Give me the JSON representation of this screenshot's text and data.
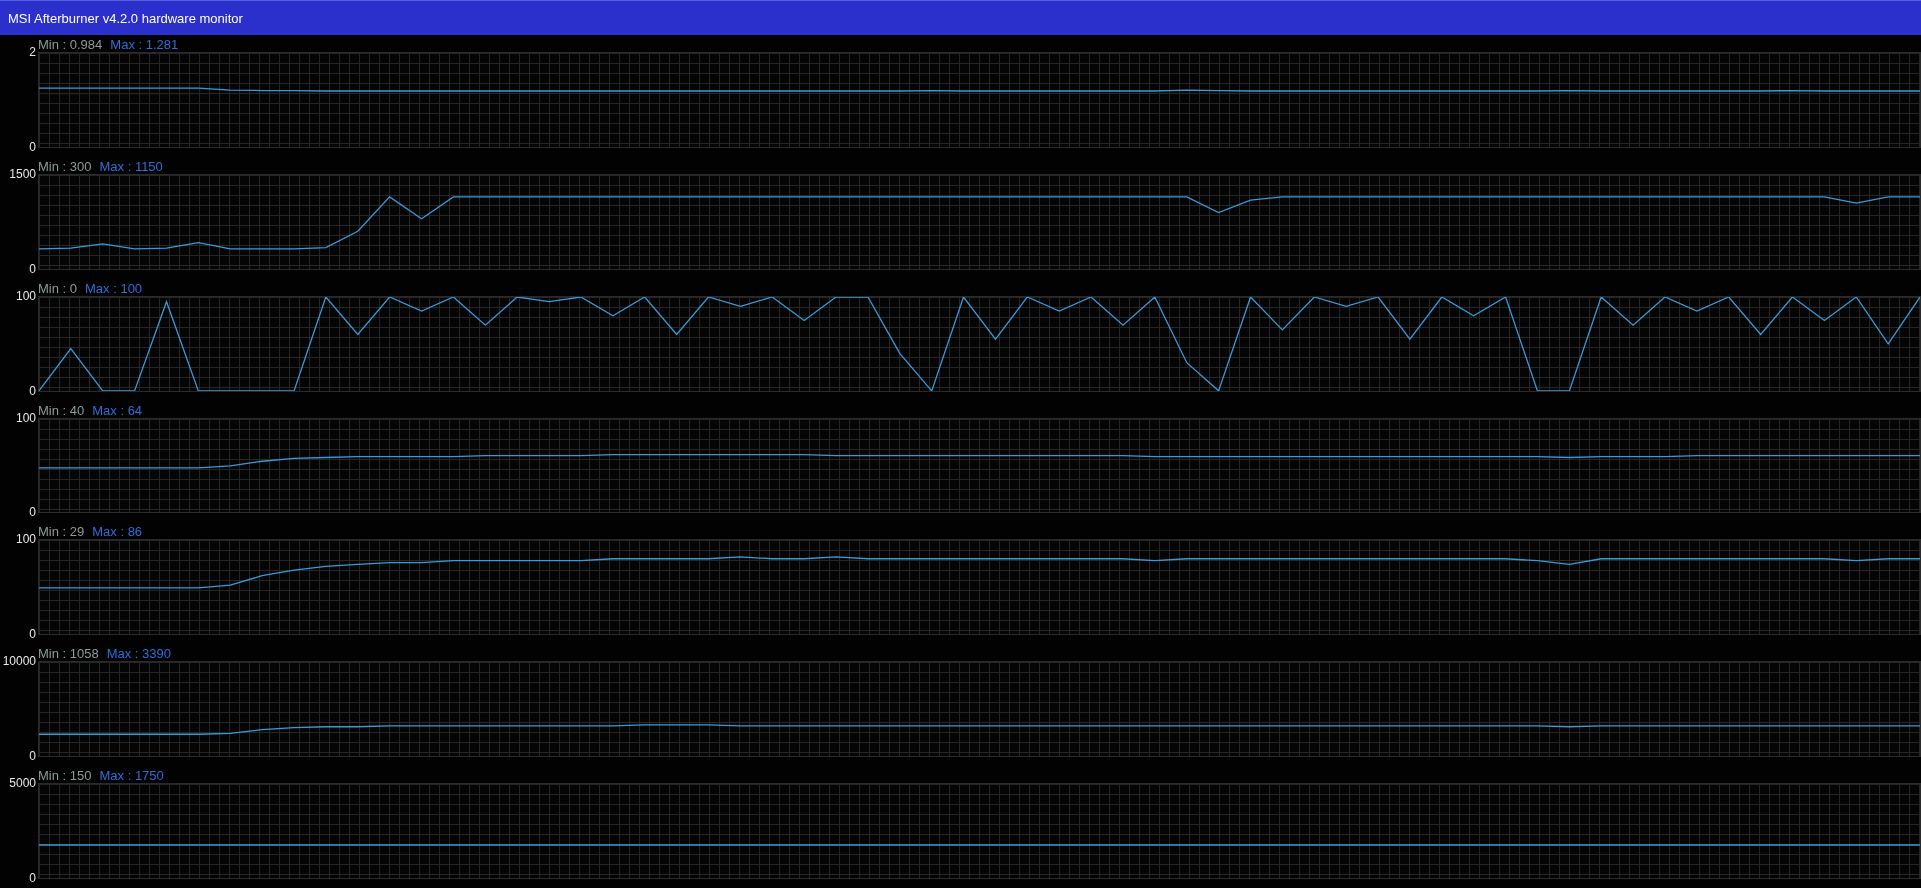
{
  "window": {
    "title": "MSI Afterburner v4.2.0 hardware monitor"
  },
  "graphs": [
    {
      "min_label": "Min : 0.984",
      "max_label": "Max : 1.281",
      "chart_data": {
        "type": "line",
        "ylim": [
          0,
          2
        ],
        "yticks": [
          0,
          2
        ],
        "series": [
          {
            "color": "#3a9ad9",
            "values": [
              1.25,
              1.25,
              1.25,
              1.25,
              1.25,
              1.25,
              1.21,
              1.2,
              1.2,
              1.19,
              1.19,
              1.19,
              1.19,
              1.19,
              1.19,
              1.19,
              1.19,
              1.19,
              1.19,
              1.19,
              1.19,
              1.19,
              1.19,
              1.19,
              1.19,
              1.19,
              1.19,
              1.19,
              1.2,
              1.19,
              1.19,
              1.19,
              1.19,
              1.19,
              1.19,
              1.19,
              1.21,
              1.2,
              1.19,
              1.19,
              1.19,
              1.19,
              1.19,
              1.19,
              1.19,
              1.19,
              1.19,
              1.19,
              1.2,
              1.19,
              1.19,
              1.19,
              1.19,
              1.19,
              1.19,
              1.2,
              1.19,
              1.19,
              1.19,
              1.19
            ]
          }
        ]
      }
    },
    {
      "min_label": "Min : 300",
      "max_label": "Max : 1150",
      "chart_data": {
        "type": "line",
        "ylim": [
          0,
          1500
        ],
        "yticks": [
          0,
          1500
        ],
        "series": [
          {
            "color": "#3a9ad9",
            "values": [
              320,
              330,
              400,
              320,
              330,
              420,
              320,
              320,
              320,
              340,
              600,
              1150,
              800,
              1150,
              1150,
              1150,
              1150,
              1150,
              1150,
              1150,
              1150,
              1150,
              1150,
              1150,
              1150,
              1150,
              1150,
              1150,
              1150,
              1150,
              1150,
              1150,
              1150,
              1150,
              1150,
              1150,
              1150,
              900,
              1100,
              1150,
              1150,
              1150,
              1150,
              1150,
              1150,
              1150,
              1150,
              1150,
              1150,
              1150,
              1150,
              1150,
              1150,
              1150,
              1150,
              1150,
              1150,
              1050,
              1150,
              1150
            ]
          }
        ]
      }
    },
    {
      "min_label": "Min : 0",
      "max_label": "Max : 100",
      "chart_data": {
        "type": "line",
        "ylim": [
          0,
          100
        ],
        "yticks": [
          0,
          100
        ],
        "series": [
          {
            "color": "#3a9ad9",
            "values": [
              0,
              45,
              0,
              0,
              95,
              0,
              0,
              0,
              0,
              100,
              60,
              100,
              85,
              100,
              70,
              100,
              95,
              100,
              80,
              100,
              60,
              100,
              90,
              100,
              75,
              100,
              100,
              40,
              0,
              100,
              55,
              100,
              85,
              100,
              70,
              100,
              30,
              0,
              100,
              65,
              100,
              90,
              100,
              55,
              100,
              80,
              100,
              0,
              0,
              100,
              70,
              100,
              85,
              100,
              60,
              100,
              75,
              100,
              50,
              100
            ]
          }
        ]
      }
    },
    {
      "min_label": "Min : 40",
      "max_label": "Max : 64",
      "chart_data": {
        "type": "line",
        "ylim": [
          0,
          100
        ],
        "yticks": [
          0,
          100
        ],
        "series": [
          {
            "color": "#3a9ad9",
            "values": [
              48,
              48,
              48,
              48,
              48,
              48,
              50,
              55,
              58,
              59,
              60,
              60,
              60,
              60,
              61,
              61,
              61,
              61,
              62,
              62,
              62,
              62,
              62,
              62,
              62,
              61,
              61,
              61,
              61,
              61,
              61,
              61,
              61,
              61,
              61,
              60,
              60,
              60,
              60,
              60,
              60,
              60,
              60,
              60,
              60,
              60,
              60,
              60,
              59,
              60,
              60,
              60,
              61,
              61,
              61,
              61,
              61,
              61,
              61,
              61
            ]
          }
        ]
      }
    },
    {
      "min_label": "Min : 29",
      "max_label": "Max : 86",
      "chart_data": {
        "type": "line",
        "ylim": [
          0,
          100
        ],
        "yticks": [
          0,
          100
        ],
        "series": [
          {
            "color": "#3a9ad9",
            "values": [
              49,
              49,
              49,
              49,
              49,
              49,
              52,
              62,
              68,
              72,
              74,
              76,
              76,
              78,
              78,
              78,
              78,
              78,
              80,
              80,
              80,
              80,
              82,
              80,
              80,
              82,
              80,
              80,
              80,
              80,
              80,
              80,
              80,
              80,
              80,
              78,
              80,
              80,
              80,
              80,
              80,
              80,
              80,
              80,
              80,
              80,
              80,
              78,
              74,
              80,
              80,
              80,
              80,
              80,
              80,
              80,
              80,
              78,
              80,
              80
            ]
          }
        ]
      }
    },
    {
      "min_label": "Min : 1058",
      "max_label": "Max : 3390",
      "chart_data": {
        "type": "line",
        "ylim": [
          0,
          10000
        ],
        "yticks": [
          0,
          10000
        ],
        "series": [
          {
            "color": "#3a9ad9",
            "values": [
              2300,
              2300,
              2300,
              2300,
              2300,
              2300,
              2400,
              2800,
              3000,
              3100,
              3100,
              3200,
              3200,
              3200,
              3200,
              3200,
              3200,
              3200,
              3200,
              3300,
              3300,
              3300,
              3200,
              3200,
              3200,
              3200,
              3200,
              3200,
              3200,
              3200,
              3200,
              3200,
              3200,
              3200,
              3200,
              3200,
              3200,
              3200,
              3200,
              3200,
              3200,
              3200,
              3200,
              3200,
              3200,
              3200,
              3200,
              3200,
              3100,
              3200,
              3200,
              3200,
              3200,
              3200,
              3200,
              3200,
              3200,
              3200,
              3200,
              3200
            ]
          }
        ]
      }
    },
    {
      "min_label": "Min : 150",
      "max_label": "Max : 1750",
      "chart_data": {
        "type": "line",
        "ylim": [
          0,
          5000
        ],
        "yticks": [
          0,
          5000
        ],
        "series": [
          {
            "color": "#3a9ad9",
            "values": [
              1750,
              1750,
              1750,
              1750,
              1750,
              1750,
              1750,
              1750,
              1750,
              1750,
              1750,
              1750,
              1750,
              1750,
              1750,
              1750,
              1750,
              1750,
              1750,
              1750,
              1750,
              1750,
              1750,
              1750,
              1750,
              1750,
              1750,
              1750,
              1750,
              1750,
              1750,
              1750,
              1750,
              1750,
              1750,
              1750,
              1750,
              1750,
              1750,
              1750,
              1750,
              1750,
              1750,
              1750,
              1750,
              1750,
              1750,
              1750,
              1750,
              1750,
              1750,
              1750,
              1750,
              1750,
              1750,
              1750,
              1750,
              1750,
              1750,
              1750
            ]
          }
        ]
      }
    }
  ]
}
